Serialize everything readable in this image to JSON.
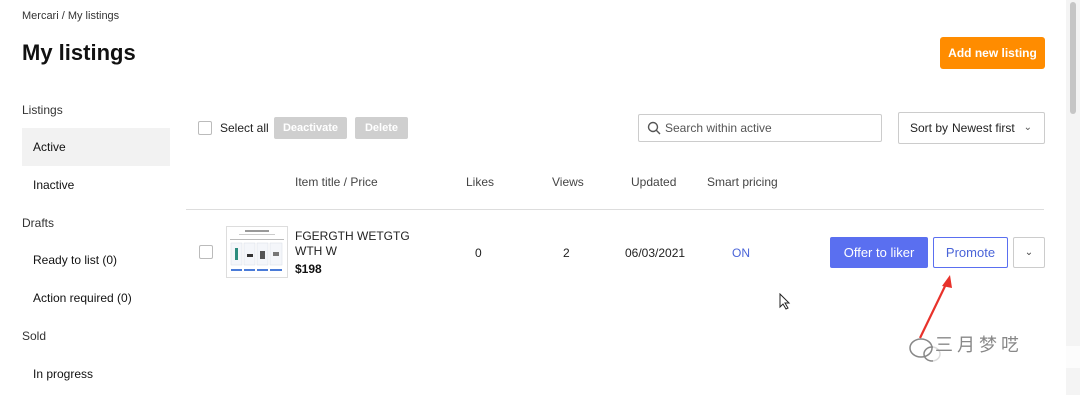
{
  "breadcrumb": "Mercari / My listings",
  "page_title": "My listings",
  "add_button_label": "Add new listing",
  "sidebar": {
    "listings_header": "Listings",
    "active_label": "Active",
    "inactive_label": "Inactive",
    "drafts_header": "Drafts",
    "ready_label": "Ready to list (0)",
    "action_label": "Action required (0)",
    "sold_header": "Sold",
    "in_progress_label": "In progress"
  },
  "toolbar": {
    "select_all_label": "Select all",
    "deactivate_label": "Deactivate",
    "delete_label": "Delete",
    "search_placeholder": "Search within active",
    "sort_label": "Sort by",
    "sort_value": "Newest first"
  },
  "table": {
    "columns": [
      "Item title / Price",
      "Likes",
      "Views",
      "Updated",
      "Smart pricing"
    ],
    "rows": [
      {
        "title": "FGERGTH WETGTG WTH W",
        "price": "$198",
        "likes": "0",
        "views": "2",
        "updated": "06/03/2021",
        "smart_pricing": "ON",
        "offer_label": "Offer to liker",
        "promote_label": "Promote"
      }
    ]
  },
  "watermark_text": "三月梦呓",
  "colors": {
    "brand_orange": "#ff8c00",
    "primary_blue": "#5a6ff0",
    "link_blue": "#4a64d8",
    "disabled_gray": "#cfcfcf",
    "annotation_red": "#e8322b"
  },
  "icons": [
    "search-icon",
    "chevron-down-icon",
    "cursor-icon",
    "annotation-arrow-icon",
    "wechat-icon"
  ]
}
